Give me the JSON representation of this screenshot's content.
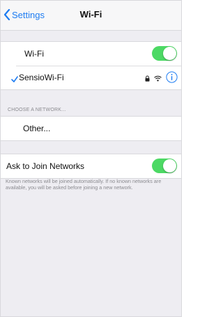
{
  "nav": {
    "back_label": "Settings",
    "title": "Wi-Fi"
  },
  "wifi_toggle": {
    "label": "Wi-Fi",
    "on": true
  },
  "connected_network": {
    "name": "SensioWi-Fi",
    "icons": [
      "checkmark-icon",
      "lock-icon",
      "wifi-icon",
      "info-icon"
    ]
  },
  "choose_network": {
    "header": "CHOOSE A NETWORK...",
    "other_label": "Other..."
  },
  "ask_to_join": {
    "label": "Ask to Join Networks",
    "on": true,
    "footnote": "Known networks will be joined automatically. If no known networks are available, you will be asked before joining a new network."
  },
  "colors": {
    "accent": "#1d7cf2",
    "toggle_on": "#4cd964",
    "background": "#eeedf2"
  }
}
